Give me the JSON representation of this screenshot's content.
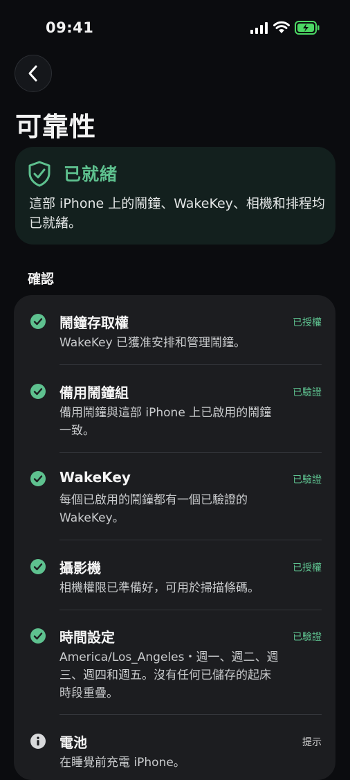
{
  "status_bar": {
    "time": "09:41"
  },
  "header": {
    "title": "可靠性"
  },
  "ready": {
    "title": "已就緒",
    "description": "這部 iPhone 上的鬧鐘、WakeKey、相機和排程均已就緒。"
  },
  "section": {
    "label": "確認"
  },
  "checks": [
    {
      "title": "鬧鐘存取權",
      "description": "WakeKey 已獲准安排和管理鬧鐘。",
      "status": "已授權"
    },
    {
      "title": "備用鬧鐘組",
      "description": "備用鬧鐘與這部 iPhone 上已啟用的鬧鐘一致。",
      "status": "已驗證"
    },
    {
      "title": "WakeKey",
      "description": "每個已啟用的鬧鐘都有一個已驗證的 WakeKey。",
      "status": "已驗證"
    },
    {
      "title": "攝影機",
      "description": "相機權限已準備好，可用於掃描條碼。",
      "status": "已授權"
    },
    {
      "title": "時間設定",
      "description": "America/Los_Angeles・週一、週二、週三、週四和週五。沒有任何已儲存的起床時段重疊。",
      "status": "已驗證"
    },
    {
      "title": "電池",
      "description": "在睡覺前充電 iPhone。",
      "status": "提示"
    }
  ],
  "colors": {
    "accent": "#5ec18f",
    "background": "#0b0c0f",
    "card": "#1c1d20",
    "ready_card": "#13201e"
  }
}
